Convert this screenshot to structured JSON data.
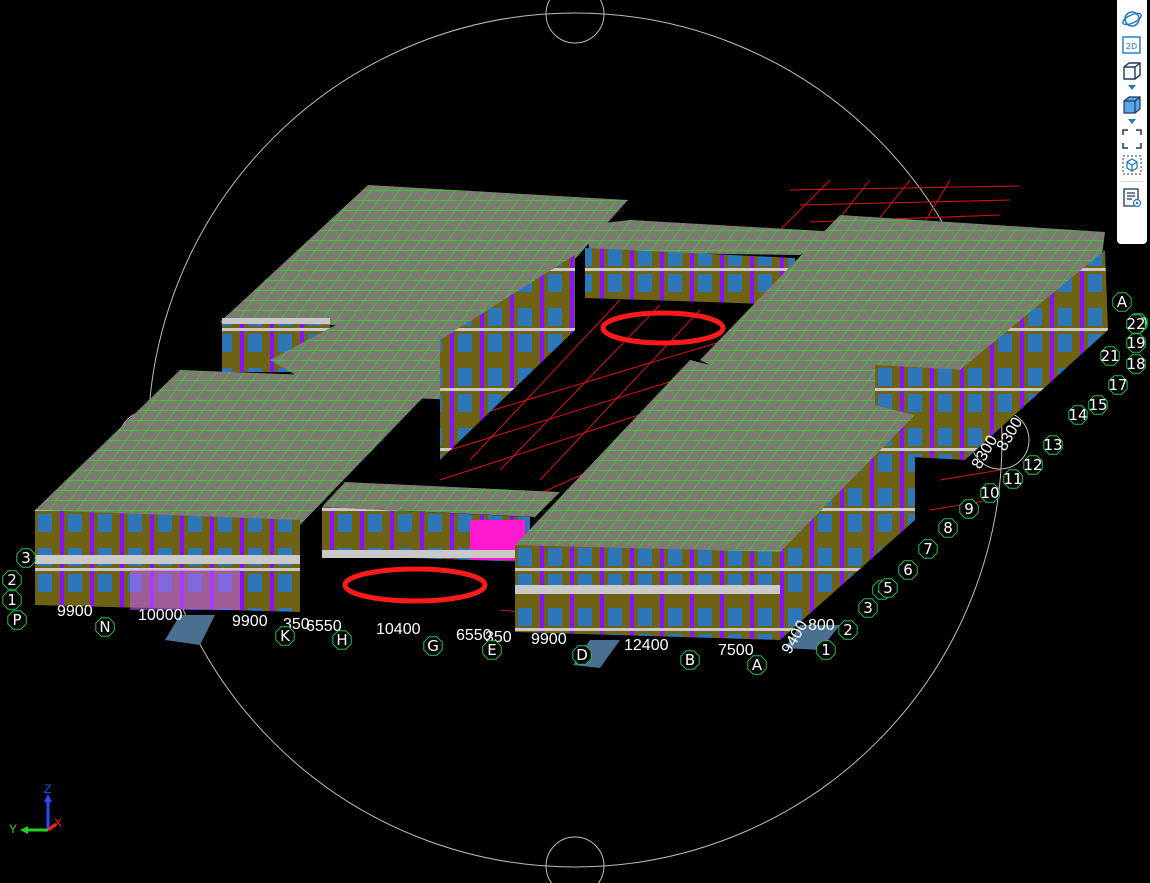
{
  "viewport": {
    "grid_letters": [
      {
        "label": "P"
      },
      {
        "label": "N"
      },
      {
        "label": "K"
      },
      {
        "label": "H"
      },
      {
        "label": "G"
      },
      {
        "label": "E"
      },
      {
        "label": "D"
      },
      {
        "label": "B"
      },
      {
        "label": "A"
      },
      {
        "label": "A"
      }
    ],
    "grid_numbers": [
      {
        "label": "1"
      },
      {
        "label": "2"
      },
      {
        "label": "3"
      },
      {
        "label": "4"
      },
      {
        "label": "5"
      },
      {
        "label": "6"
      },
      {
        "label": "7"
      },
      {
        "label": "8"
      },
      {
        "label": "9"
      },
      {
        "label": "10"
      },
      {
        "label": "11"
      },
      {
        "label": "12"
      },
      {
        "label": "13"
      },
      {
        "label": "14"
      },
      {
        "label": "15"
      },
      {
        "label": "17"
      },
      {
        "label": "18"
      },
      {
        "label": "19"
      },
      {
        "label": "20"
      },
      {
        "label": "21"
      },
      {
        "label": "22"
      },
      {
        "label": "1"
      },
      {
        "label": "2"
      },
      {
        "label": "3"
      }
    ],
    "dimensions": [
      "9900",
      "10000",
      "9900",
      "350",
      "6550",
      "10400",
      "6550",
      "350",
      "9900",
      "12400",
      "7500",
      "800",
      "9400",
      "8300",
      "8300"
    ],
    "colors": {
      "background": "#000000",
      "roof_grid": "#3fd23a",
      "wall_magenta": "#8a10ff",
      "wall_olive": "#7a6a10",
      "floor_band": "#c9c9c9",
      "highlight_ellipse": "#ff1a1a",
      "grid_red": "#e01010",
      "bubble_green": "#22c24a",
      "navigator_circle": "#bfbfbf"
    }
  },
  "toolbar": {
    "buttons": [
      {
        "icon": "orbit-icon"
      },
      {
        "icon": "view-2d-icon",
        "label": "2D"
      },
      {
        "icon": "view-3d-box-icon"
      },
      {
        "icon": "solid-box-icon"
      },
      {
        "icon": "zoom-extents-icon"
      },
      {
        "icon": "view-cube-icon"
      },
      {
        "icon": "properties-list-icon"
      }
    ]
  },
  "axis_triad": {
    "x": "X",
    "y": "Y",
    "z": "Z"
  }
}
